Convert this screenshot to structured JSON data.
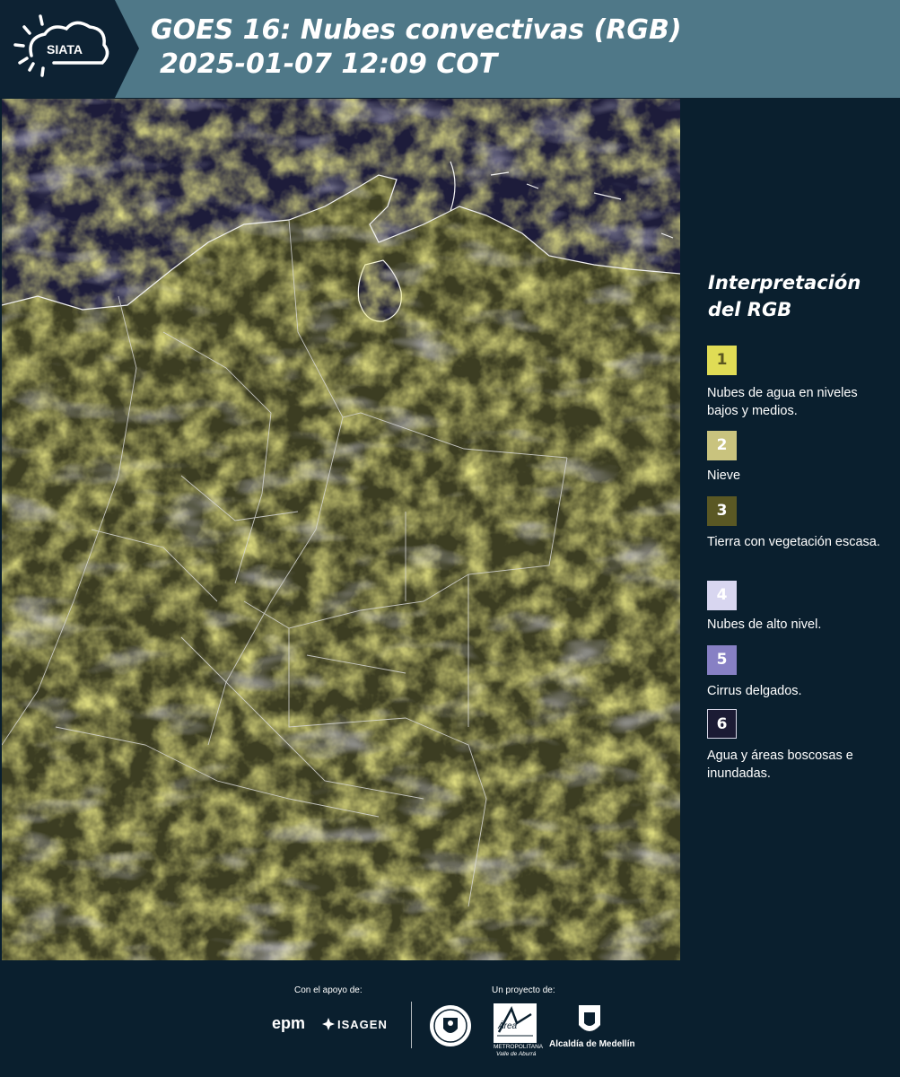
{
  "header": {
    "logo_text": "SIATA",
    "title_line1": "GOES 16: Nubes convectivas (RGB)",
    "title_line2": "2025-01-07 12:09 COT",
    "bg_color": "#4f7888",
    "logo_bg_color": "#0d2233"
  },
  "legend": {
    "title": "Interpretación del RGB",
    "items": [
      {
        "number": "1",
        "label": "Nubes de agua en niveles bajos y medios.",
        "color": "#e0dc55"
      },
      {
        "number": "2",
        "label": "Nieve",
        "color": "#c9c37e"
      },
      {
        "number": "3",
        "label": "Tierra con vegetación escasa.",
        "color": "#5a5824"
      },
      {
        "number": "4",
        "label": "Nubes de alto nivel.",
        "color": "#d8d6f0"
      },
      {
        "number": "5",
        "label": "Cirrus delgados.",
        "color": "#8780c4"
      },
      {
        "number": "6",
        "label": "Agua y áreas boscosas e inundadas.",
        "color": "#1b1b34"
      }
    ]
  },
  "footer": {
    "support_label": "Con el apoyo de:",
    "project_label": "Un proyecto de:",
    "epm": "epm",
    "isagen": "ISAGEN",
    "metropolitana_name": "Área",
    "metropolitana_sub1": "METROPOLITANA",
    "metropolitana_sub2": "Valle de Aburrá",
    "alcaldia": "Alcaldía de Medellín"
  },
  "icons": [
    "siata-sun-cloud-logo",
    "epm-logo",
    "isagen-logo",
    "medellin-seal",
    "area-metropolitana-logo",
    "alcaldia-logo"
  ]
}
